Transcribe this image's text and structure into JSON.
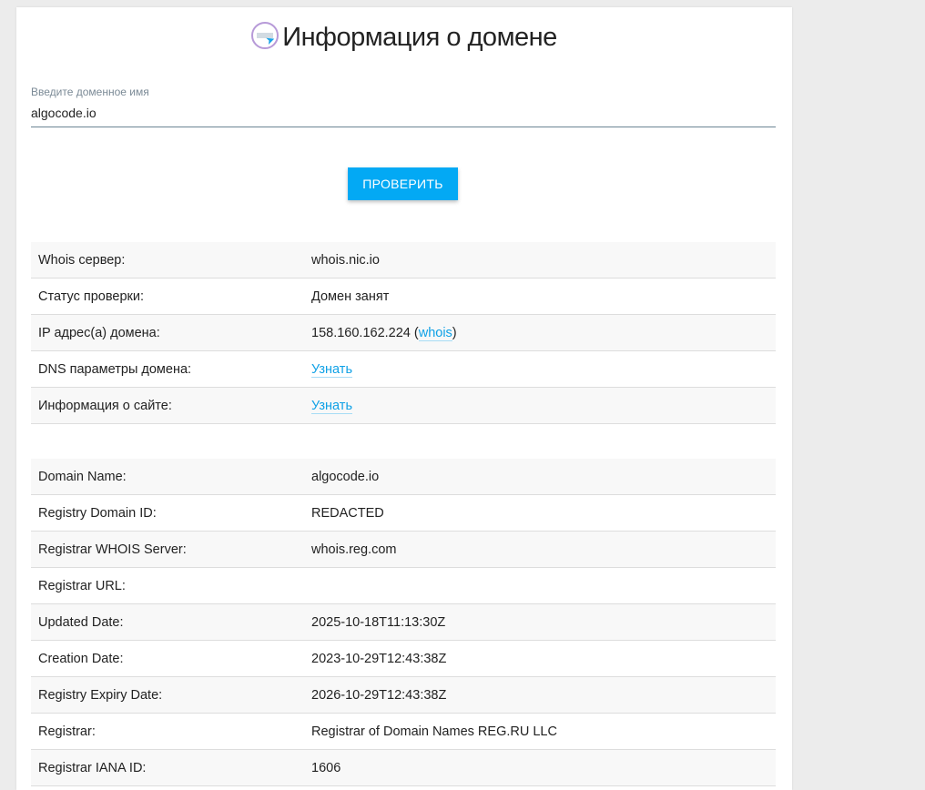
{
  "header": {
    "title": "Информация о домене",
    "logo_icon": "domain-search-icon"
  },
  "form": {
    "label": "Введите доменное имя",
    "value": "algocode.io",
    "submit_label": "ПРОВЕРИТЬ"
  },
  "summary": {
    "rows": [
      {
        "key": "Whois сервер:",
        "value": "whois.nic.io"
      },
      {
        "key": "Статус проверки:",
        "value": "Домен занят"
      },
      {
        "key": "IP адрес(а) домена:",
        "value": "158.160.162.224",
        "link": "whois"
      },
      {
        "key": "DNS параметры домена:",
        "link": "Узнать"
      },
      {
        "key": "Информация о сайте:",
        "link": "Узнать"
      }
    ]
  },
  "whois": {
    "rows": [
      {
        "key": "Domain Name:",
        "value": "algocode.io"
      },
      {
        "key": "Registry Domain ID:",
        "value": "REDACTED"
      },
      {
        "key": "Registrar WHOIS Server:",
        "value": "whois.reg.com"
      },
      {
        "key": "Registrar URL:",
        "value": ""
      },
      {
        "key": "Updated Date:",
        "value": "2025-10-18T11:13:30Z"
      },
      {
        "key": "Creation Date:",
        "value": "2023-10-29T12:43:38Z"
      },
      {
        "key": "Registry Expiry Date:",
        "value": "2026-10-29T12:43:38Z"
      },
      {
        "key": "Registrar:",
        "value": "Registrar of Domain Names REG.RU LLC"
      },
      {
        "key": "Registrar IANA ID:",
        "value": "1606"
      }
    ]
  },
  "colors": {
    "accent": "#03a9f4",
    "link": "#0fa1e6",
    "background": "#ececec"
  }
}
